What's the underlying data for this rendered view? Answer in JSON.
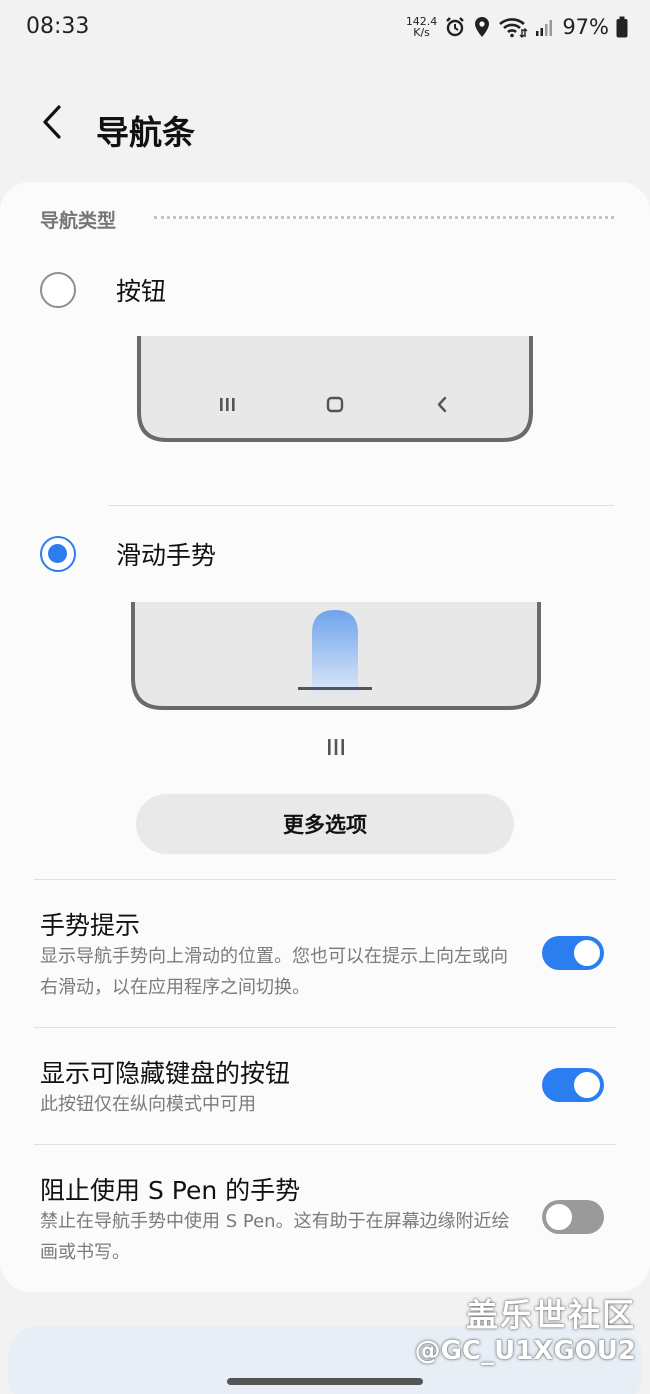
{
  "status_bar": {
    "time": "08:33",
    "net_speed_value": "142.4",
    "net_speed_unit": "K/s",
    "battery_percent": "97%",
    "icons": [
      "alarm-icon",
      "location-icon",
      "wifi-icon",
      "signal-icon",
      "battery-icon"
    ]
  },
  "header": {
    "back_icon": "chevron-left-icon",
    "title": "导航条"
  },
  "nav_type": {
    "section_label": "导航类型",
    "options": [
      {
        "label": "按钮",
        "selected": false
      },
      {
        "label": "滑动手势",
        "selected": true
      }
    ]
  },
  "more_options_label": "更多选项",
  "settings": [
    {
      "title": "手势提示",
      "desc": "显示导航手势向上滑动的位置。您也可以在提示上向左或向右滑动，以在应用程序之间切换。",
      "enabled": true
    },
    {
      "title": "显示可隐藏键盘的按钮",
      "desc": "此按钮仅在纵向模式中可用",
      "enabled": true
    },
    {
      "title": "阻止使用 S Pen 的手势",
      "desc": "禁止在导航手势中使用 S Pen。这有助于在屏幕边缘附近绘画或书写。",
      "enabled": false
    }
  ],
  "watermark": {
    "line1": "盖乐世社区",
    "line2": "@GC_U1XGOU2"
  },
  "colors": {
    "accent": "#2a7ef0",
    "background": "#f2f2f2",
    "card": "#fbfbfb",
    "toggle_off": "#9a9a9a"
  }
}
